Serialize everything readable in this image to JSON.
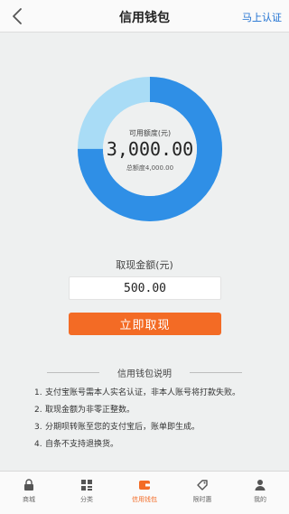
{
  "nav": {
    "title": "信用钱包",
    "right_action": "马上认证"
  },
  "credit": {
    "available_label": "可用额度(元)",
    "available_amount": "3,000.00",
    "total_label": "总额度4,000.00",
    "available_fraction": 0.75
  },
  "colors": {
    "ring_available": "#2f8fe6",
    "ring_used": "#a9dcf6",
    "accent_orange": "#f36b25",
    "link_blue": "#1c6fd1"
  },
  "withdraw": {
    "label": "取现金额(元)",
    "amount_value": "500.00",
    "submit_label": "立即取现"
  },
  "notes": {
    "title": "信用钱包说明",
    "items": [
      {
        "num": "1.",
        "text": "支付宝账号需本人实名认证，非本人账号将打款失败。"
      },
      {
        "num": "2.",
        "text": "取现金额为非零正整数。"
      },
      {
        "num": "3.",
        "text": "分期呗转账至您的支付宝后，账单即生成。"
      },
      {
        "num": "4.",
        "text": "自条不支持退换货。"
      }
    ]
  },
  "tabbar": {
    "items": [
      {
        "label": "商城",
        "icon": "lock-bag-icon"
      },
      {
        "label": "分类",
        "icon": "grid-icon"
      },
      {
        "label": "信用钱包",
        "icon": "wallet-icon",
        "active": true
      },
      {
        "label": "限时惠",
        "icon": "tag-icon"
      },
      {
        "label": "我的",
        "icon": "person-icon"
      }
    ]
  }
}
